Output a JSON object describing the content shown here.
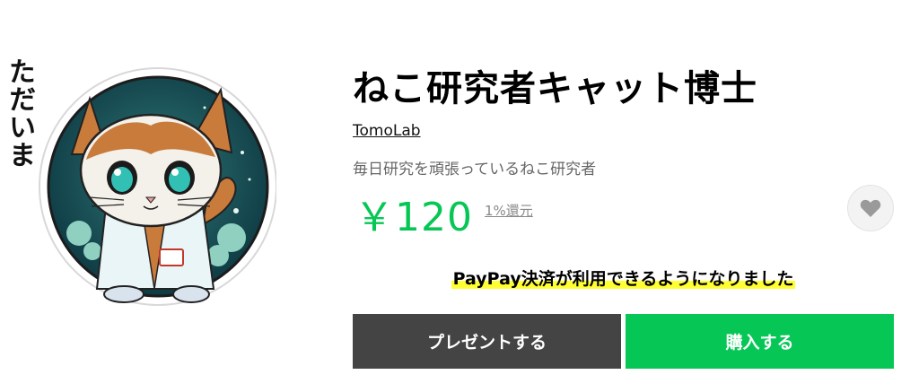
{
  "sticker": {
    "caption": "ただいま",
    "icon": "scientist-cat-sticker-image"
  },
  "product": {
    "title": "ねこ研究者キャット博士",
    "author": "TomoLab",
    "description": "毎日研究を頑張っているねこ研究者",
    "price": "￥120",
    "return_text": "1%還元"
  },
  "favorite": {
    "icon": "heart-icon"
  },
  "notice": {
    "text": "PayPay決済が利用できるようになりました"
  },
  "buttons": {
    "gift_label": "プレゼントする",
    "buy_label": "購入する"
  },
  "colors": {
    "accent_green": "#06c755",
    "gift_button": "#444444",
    "highlight": "#ffff33"
  }
}
